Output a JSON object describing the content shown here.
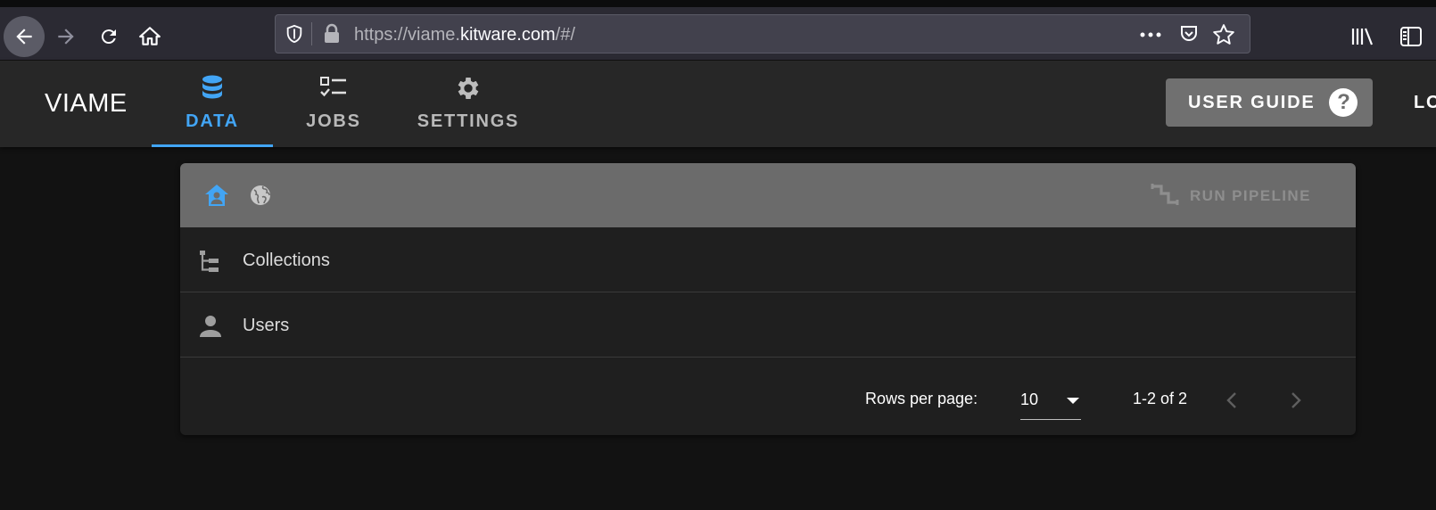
{
  "browser": {
    "url_prefix": "https://viame.",
    "url_host": "kitware.com",
    "url_suffix": "/#/"
  },
  "app": {
    "title": "VIAME",
    "tabs": [
      {
        "label": "DATA",
        "icon": "database-icon",
        "active": true
      },
      {
        "label": "JOBS",
        "icon": "checklist-icon",
        "active": false
      },
      {
        "label": "SETTINGS",
        "icon": "gear-icon",
        "active": false
      }
    ],
    "user_guide_label": "USER GUIDE",
    "help_glyph": "?",
    "logout_label": "LO"
  },
  "toolbar": {
    "home_icon": "home-account-icon",
    "globe_icon": "globe-icon",
    "run_pipeline_label": "RUN PIPELINE"
  },
  "list": {
    "items": [
      {
        "label": "Collections",
        "icon": "file-tree-icon"
      },
      {
        "label": "Users",
        "icon": "account-icon"
      }
    ]
  },
  "pagination": {
    "rows_per_page_label": "Rows per page:",
    "rows_per_page_value": "10",
    "range_text": "1-2 of 2"
  },
  "colors": {
    "accent": "#42a5f5",
    "app_bar": "#272727",
    "background": "#121212",
    "toolbar": "#6b6b6b"
  }
}
